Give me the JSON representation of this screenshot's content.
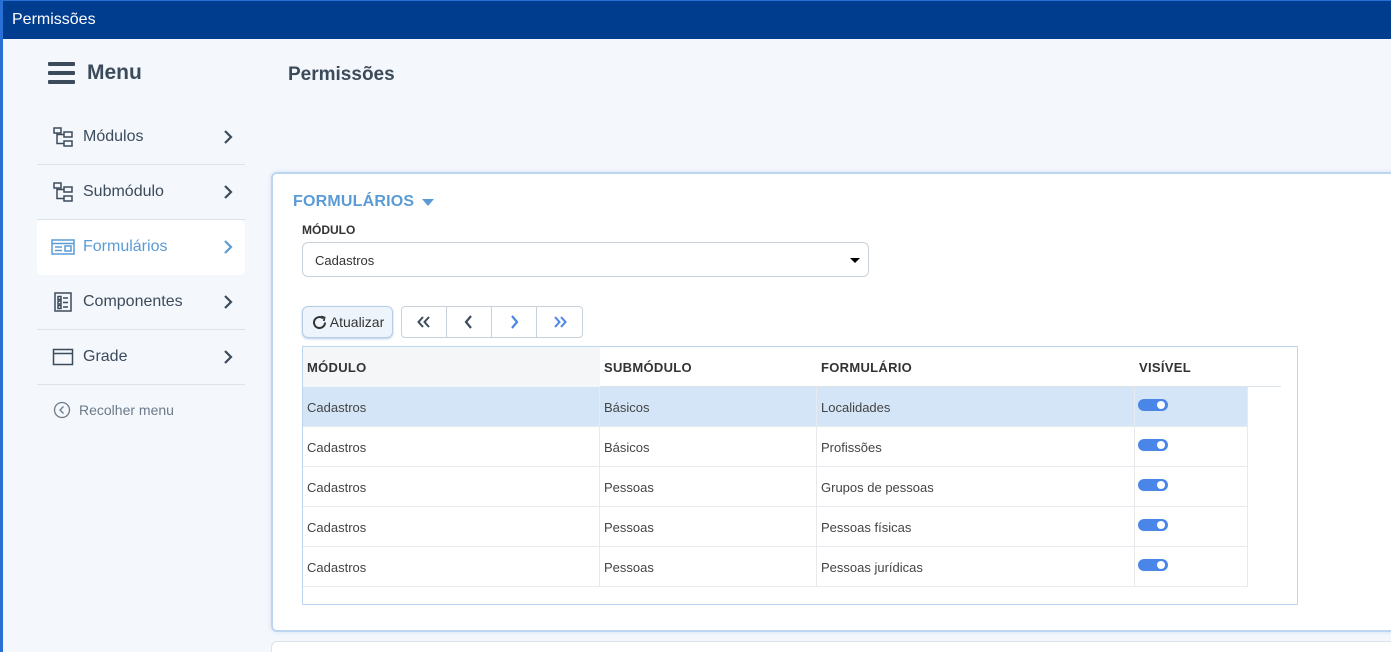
{
  "window": {
    "title": "Permissões"
  },
  "sidebar": {
    "menu_label": "Menu",
    "items": [
      {
        "label": "Módulos",
        "icon": "sitemap-icon",
        "active": false
      },
      {
        "label": "Submódulo",
        "icon": "sitemap-icon",
        "active": false
      },
      {
        "label": "Formulários",
        "icon": "form-icon",
        "active": true
      },
      {
        "label": "Componentes",
        "icon": "checklist-icon",
        "active": false
      },
      {
        "label": "Grade",
        "icon": "window-icon",
        "active": false
      }
    ],
    "collapse_label": "Recolher menu"
  },
  "page": {
    "title": "Permissões"
  },
  "form": {
    "section_title": "FORMULÁRIOS",
    "module_label": "MÓDULO",
    "module_value": "Cadastros",
    "refresh_label": "Atualizar"
  },
  "grid": {
    "columns": [
      "MÓDULO",
      "SUBMÓDULO",
      "FORMULÁRIO",
      "VISÍVEL"
    ],
    "rows": [
      {
        "modulo": "Cadastros",
        "submodulo": "Básicos",
        "formulario": "Localidades",
        "visivel": true,
        "selected": true
      },
      {
        "modulo": "Cadastros",
        "submodulo": "Básicos",
        "formulario": "Profissões",
        "visivel": true,
        "selected": false
      },
      {
        "modulo": "Cadastros",
        "submodulo": "Pessoas",
        "formulario": "Grupos de pessoas",
        "visivel": true,
        "selected": false
      },
      {
        "modulo": "Cadastros",
        "submodulo": "Pessoas",
        "formulario": "Pessoas físicas",
        "visivel": true,
        "selected": false
      },
      {
        "modulo": "Cadastros",
        "submodulo": "Pessoas",
        "formulario": "Pessoas jurídicas",
        "visivel": true,
        "selected": false
      }
    ]
  },
  "colors": {
    "titlebar": "#003d8f",
    "accent": "#5b9bd5",
    "toggle": "#4a86e8",
    "selected_row": "#d4e5f7"
  }
}
